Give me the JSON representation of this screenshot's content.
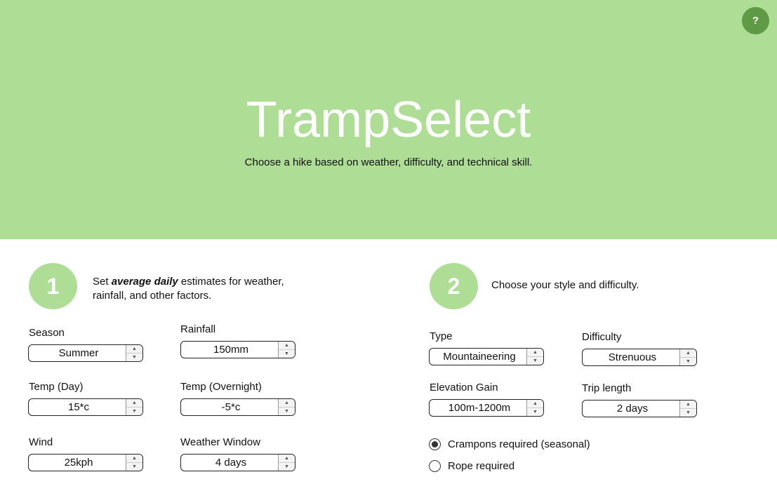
{
  "header": {
    "title": "TrampSelect",
    "subtitle": "Choose a hike based on weather, difficulty, and technical skill.",
    "help_label": "?"
  },
  "step1": {
    "number": "1",
    "text_prefix": "Set ",
    "text_emphasis": "average daily",
    "text_suffix": " estimates for weather, rainfall, and other factors.",
    "fields": {
      "season": {
        "label": "Season",
        "value": "Summer"
      },
      "rainfall": {
        "label": "Rainfall",
        "value": "150mm"
      },
      "temp_day": {
        "label": "Temp (Day)",
        "value": "15*c"
      },
      "temp_night": {
        "label": "Temp (Overnight)",
        "value": "-5*c"
      },
      "wind": {
        "label": "Wind",
        "value": "25kph"
      },
      "weather_window": {
        "label": "Weather Window",
        "value": "4 days"
      }
    }
  },
  "step2": {
    "number": "2",
    "text": "Choose your style and difficulty.",
    "fields": {
      "type": {
        "label": "Type",
        "value": "Mountaineering"
      },
      "difficulty": {
        "label": "Difficulty",
        "value": "Strenuous"
      },
      "elevation": {
        "label": "Elevation Gain",
        "value": "100m-1200m"
      },
      "trip_length": {
        "label": "Trip length",
        "value": "2 days"
      }
    },
    "options": [
      {
        "label": "Crampons required (seasonal)",
        "checked": true
      },
      {
        "label": "Rope required",
        "checked": false
      }
    ]
  },
  "icons": {
    "up": "up-arrow-icon",
    "down": "down-arrow-icon"
  }
}
